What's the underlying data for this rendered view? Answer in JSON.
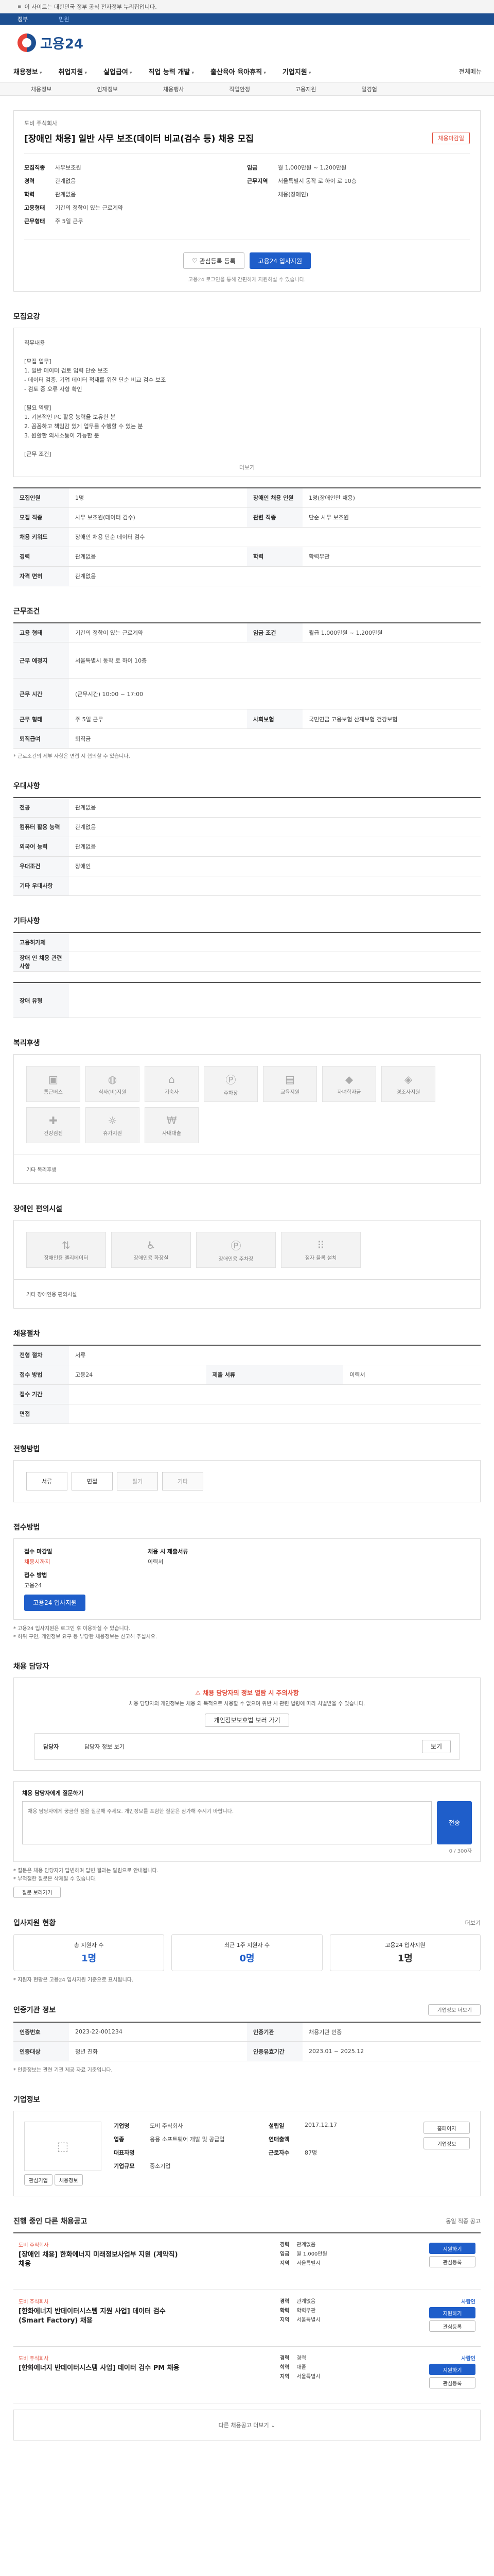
{
  "topnotice": "이 사이트는 대한민국 정부 공식 전자정부 누리집입니다.",
  "gov": [
    "정부",
    "민원"
  ],
  "logo": "고용24",
  "gnb": [
    "채용정보",
    "취업지원",
    "실업급여",
    "직업 능력 개발",
    "출산육아 육아휴직",
    "기업지원"
  ],
  "gnb_right": "전체메뉴",
  "subnav": [
    "채용정보",
    "인재정보",
    "채용행사",
    "직업안정",
    "고용지원",
    "일경험"
  ],
  "header": {
    "company": "도비 주식회사",
    "title": "[장애인 채용] 일반 사무 보조(데이터 비교(검수 등) 채용 모집",
    "badge": "채용마감일",
    "left": [
      [
        "모집직종",
        "사무보조원"
      ],
      [
        "경력",
        "관계없음"
      ],
      [
        "학력",
        "관계없음"
      ],
      [
        "고용형태",
        "기간의 정함이 있는 근로계약"
      ],
      [
        "근무형태",
        "주 5일 근무"
      ]
    ],
    "right": [
      [
        "임금",
        "월 1,000만원 ~ 1,200만원"
      ],
      [
        "근무지역",
        "서울특별시 동작 로 하이 로 10층"
      ],
      [
        "",
        "채용(장애인)"
      ]
    ],
    "btn_save": "관심등록 등록",
    "btn_apply": "고용24 입사지원",
    "note": "고용24 로그인을 통해 간편하게 지원하실 수 있습니다."
  },
  "requirements": {
    "title": "모집요강",
    "body": "직무내용\n\n[모집 업무]\n1. 일반 데이터 검토 입력 단순 보조\n - 데이터 검증, 기업 데이터 적재를 위한 단순 비교 검수 보조\n - 검토 중 오류 사항 확인\n\n[필요 역량]\n1. 기본적인 PC 활용 능력을 보유한 분\n2. 꼼꼼하고 책임감 있게 업무를 수행할 수 있는 분\n3. 원활한 의사소통이 가능한 분\n\n[근무 조건]\n",
    "more": "더보기"
  },
  "job_grid": [
    [
      [
        "모집인원",
        "1명"
      ],
      [
        "장애인 채용 인원",
        "1명(장애인만 채용)"
      ]
    ],
    [
      [
        "모집 직종",
        "사무 보조원(데이터 검수)"
      ],
      [
        "관련 직종",
        "단순 사무 보조원"
      ]
    ],
    [
      [
        "채용 키워드",
        "장애인 채용 단순 데이터 검수"
      ],
      [
        "",
        ""
      ]
    ],
    [
      [
        "경력",
        "관계없음"
      ],
      [
        "학력",
        "학력무관"
      ]
    ],
    [
      [
        "자격 면허",
        "관계없음"
      ],
      [
        "",
        ""
      ]
    ]
  ],
  "cond_title": "근무조건",
  "cond_grid": [
    [
      [
        "고용 형태",
        "기간의 정함이 있는 근로계약"
      ],
      [
        "임금 조건",
        "월급 1,000만원 ~ 1,200만원"
      ]
    ],
    [
      [
        "근무 예정지",
        "서울특별시 동작 로 하이 10층"
      ],
      [
        "",
        ""
      ]
    ],
    [
      [
        "근무 시간",
        "(근무시간) 10:00 ~ 17:00"
      ],
      [
        "",
        ""
      ]
    ],
    [
      [
        "근무 형태",
        "주 5일 근무"
      ],
      [
        "사회보험",
        "국민연금 고용보험 산재보험 건강보험"
      ]
    ],
    [
      [
        "퇴직급여",
        "퇴직금"
      ],
      [
        "",
        ""
      ]
    ]
  ],
  "cond_note": "* 근로조건의 세부 사항은 면접 시 협의할 수 있습니다.",
  "welfare_title": "우대사항",
  "welfare_grid": [
    [
      [
        "전공",
        "관계없음"
      ]
    ],
    [
      [
        "컴퓨터 활용 능력",
        "관계없음"
      ]
    ],
    [
      [
        "외국어 능력",
        "관계없음"
      ]
    ],
    [
      [
        "우대조건",
        "장애인"
      ]
    ],
    [
      [
        "기타 우대사항",
        ""
      ]
    ]
  ],
  "etc_title": "기타사항",
  "etc_grid": [
    [
      [
        "고용허가제",
        ""
      ]
    ],
    [
      [
        "장애 인 채용 관련 사항",
        ""
      ]
    ]
  ],
  "disab_grid": [
    [
      [
        "장애 유형",
        ""
      ]
    ]
  ],
  "welfare2_title": "복리후생",
  "welfare2_icons": [
    "통근버스",
    "식사(비)지원",
    "기숙사",
    "주차장",
    "교육지원",
    "자녀학자금",
    "경조사지원",
    "건강검진",
    "휴가지원",
    "사내대출"
  ],
  "welfare2_etc": "기타 복리후생",
  "support_title": "장애인 편의시설",
  "support_icons": [
    "장애인용 엘리베이터",
    "장애인용 화장실",
    "장애인용 주차장",
    "점자 블록 설치"
  ],
  "support_etc": "기타 장애인용 편의시설",
  "select_title": "채용절차",
  "select_grid": [
    [
      [
        "전형 절차",
        "서류"
      ],
      [
        "",
        ""
      ]
    ],
    [
      [
        "접수 방법",
        "고용24"
      ],
      [
        "제출 서류",
        "이력서"
      ]
    ],
    [
      [
        "접수 기간",
        ""
      ],
      [
        "",
        ""
      ]
    ],
    [
      [
        "면접",
        ""
      ],
      [
        "",
        ""
      ]
    ]
  ],
  "docs_title": "전형방법",
  "docs": [
    "서류",
    "면접",
    "필기",
    "기타"
  ],
  "apply_title": "접수방법",
  "apply_left": [
    [
      "접수 마감일",
      "채용시까지"
    ],
    [
      "접수 방법",
      "고용24"
    ]
  ],
  "apply_right": [
    [
      "채용 시 제출서류",
      "이력서"
    ],
    [
      "",
      ""
    ]
  ],
  "apply_btn": "고용24 입사지원",
  "apply_notes": "* 고용24 입사지원은 로그인 후 이용하실 수 있습니다.\n* 허위 구인, 개인정보 요구 등 부당한 채용정보는 신고해 주십시오.",
  "inq_title": "채용 담당자",
  "inq_warn": "채용 담당자의 정보 열람 시 주의사항",
  "inq_text": "채용 담당자의 개인정보는 채용 외 목적으로 사용할 수 없으며 위반 시 관련 법령에 따라 처벌받을 수 있습니다.",
  "inq_btn": "개인정보보호법 보러 가기",
  "inq_row_label": "담당자",
  "inq_row_value": "담당자 정보 보기",
  "inq_row_btn": "보기",
  "qa_title": "채용 담당자에게 질문하기",
  "qa_placeholder": "채용 담당자에게 궁금한 점을 질문해 주세요. 개인정보를 포함한 질문은 삼가해 주시기 바랍니다.",
  "qa_btn": "전송",
  "qa_counter": "0 / 300자",
  "qa_notes": "* 질문은 채용 담당자가 답변하며 답변 결과는 알림으로 안내됩니다.\n* 부적절한 질문은 삭제될 수 있습니다.",
  "qa_link": "질문 보러가기",
  "stats_title": "입사지원 현황",
  "stats_right": "더보기",
  "stats": [
    [
      "총 지원자 수",
      "1명"
    ],
    [
      "최근 1주 지원자 수",
      "0명"
    ],
    [
      "고용24 입사지원",
      "1명"
    ]
  ],
  "stats_note": "* 지원자 현황은 고용24 입사지원 기준으로 표시됩니다.",
  "info_title": "인증기관 정보",
  "info_btn": "기업정보 더보기",
  "info_grid": [
    [
      [
        "인증번호",
        "2023-22-001234"
      ],
      [
        "인증기관",
        "채용기관 인증"
      ]
    ],
    [
      [
        "인증대상",
        "청년 친화"
      ],
      [
        "인증유효기간",
        "2023.01 ~ 2025.12"
      ]
    ]
  ],
  "info_note": "* 인증정보는 관련 기관 제공 자료 기준입니다.",
  "company_title": "기업정보",
  "company_kv": [
    [
      "기업명",
      "도비 주식회사"
    ],
    [
      "업종",
      "응용 소프트웨어 개발 및 공급업"
    ],
    [
      "대표자명",
      ""
    ],
    [
      "기업규모",
      "중소기업"
    ]
  ],
  "company_kv2": [
    [
      "설립일",
      "2017.12.17"
    ],
    [
      "연매출액",
      ""
    ],
    [
      "근로자수",
      "87명"
    ]
  ],
  "company_btns": [
    "홈페이지",
    "기업정보"
  ],
  "company_logo_btns": [
    "관심기업",
    "채용정보"
  ],
  "similar_title": "진행 중인 다른 채용공고",
  "similar_right": "동일 직종 공고",
  "jobs": [
    {
      "cname": "도비 주식회사",
      "title": "[장애인 채용] 한화에너지 미래정보사업부 지원 (계약직) 채용",
      "mid": [
        [
          "경력",
          "관계없음"
        ],
        [
          "임금",
          "월 1,000만원"
        ],
        [
          "지역",
          "서울특별시"
        ]
      ],
      "b1": "지원하기",
      "b2": "관심등록",
      "saramin": ""
    },
    {
      "cname": "도비 주식회사",
      "title": "[한화에너지 반데이터시스템 지원 사업] 데이터 검수 (Smart Factory) 채용",
      "mid": [
        [
          "경력",
          "관계없음"
        ],
        [
          "학력",
          "학력무관"
        ],
        [
          "지역",
          "서울특별시"
        ]
      ],
      "b1": "지원하기",
      "b2": "관심등록",
      "saramin": "사람인"
    },
    {
      "cname": "도비 주식회사",
      "title": "[한화에너지 반데이터시스템 사업] 데이터 검수 PM 채용",
      "mid": [
        [
          "경력",
          "경력"
        ],
        [
          "학력",
          "대졸"
        ],
        [
          "지역",
          "서울특별시"
        ]
      ],
      "b1": "지원하기",
      "b2": "관심등록",
      "saramin": "사람인"
    }
  ],
  "more_label": "다른 채용공고 더보기"
}
